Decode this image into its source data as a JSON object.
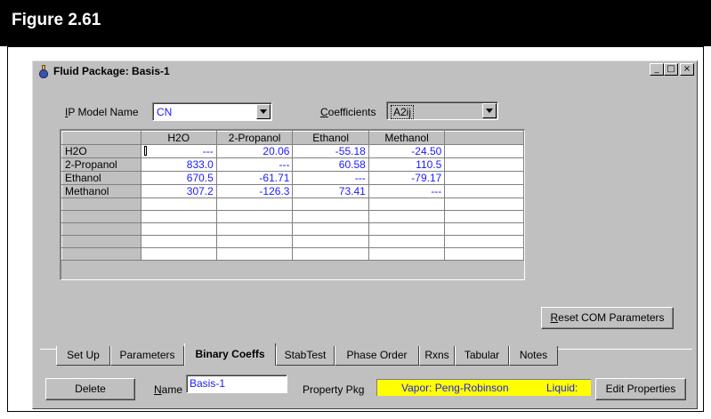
{
  "figure": {
    "title": "Figure 2.61"
  },
  "window": {
    "title": "Fluid Package: Basis-1",
    "buttons": {
      "minimize": "_",
      "maximize": "□",
      "close": "×"
    }
  },
  "ip_model": {
    "label_prefix": "",
    "label_u": "I",
    "label_rest": "P Model Name",
    "value": "CN"
  },
  "coefficients": {
    "label_u": "C",
    "label_rest": "oefficients",
    "value": "A2ij"
  },
  "grid": {
    "columns": [
      "",
      "H2O",
      "2-Propanol",
      "Ethanol",
      "Methanol",
      ""
    ],
    "rows": [
      {
        "name": "H2O",
        "values": [
          "---",
          "20.06",
          "-55.18",
          "-24.50",
          ""
        ]
      },
      {
        "name": "2-Propanol",
        "values": [
          "833.0",
          "---",
          "60.58",
          "110.5",
          ""
        ]
      },
      {
        "name": "Ethanol",
        "values": [
          "670.5",
          "-61.71",
          "---",
          "-79.17",
          ""
        ]
      },
      {
        "name": "Methanol",
        "values": [
          "307.2",
          "-126.3",
          "73.41",
          "---",
          ""
        ]
      }
    ]
  },
  "reset_button": {
    "label_u": "R",
    "label_rest": "eset COM Parameters"
  },
  "tabs": [
    "Set Up",
    "Parameters",
    "Binary Coeffs",
    "StabTest",
    "Phase Order",
    "Rxns",
    "Tabular",
    "Notes"
  ],
  "active_tab": "Binary Coeffs",
  "footer": {
    "delete_label": "Delete",
    "name_label_u": "N",
    "name_label_rest": "ame",
    "name_value": "Basis-1",
    "property_pkg_label": "Property Pkg",
    "vapor_text": "Vapor: Peng-Robinson",
    "liquid_text": "Liquid:",
    "edit_label": "Edit Properties"
  },
  "colors": {
    "value_text": "#1a1aff",
    "property_highlight": "#ffff00",
    "window_face": "#c0c0c0"
  }
}
